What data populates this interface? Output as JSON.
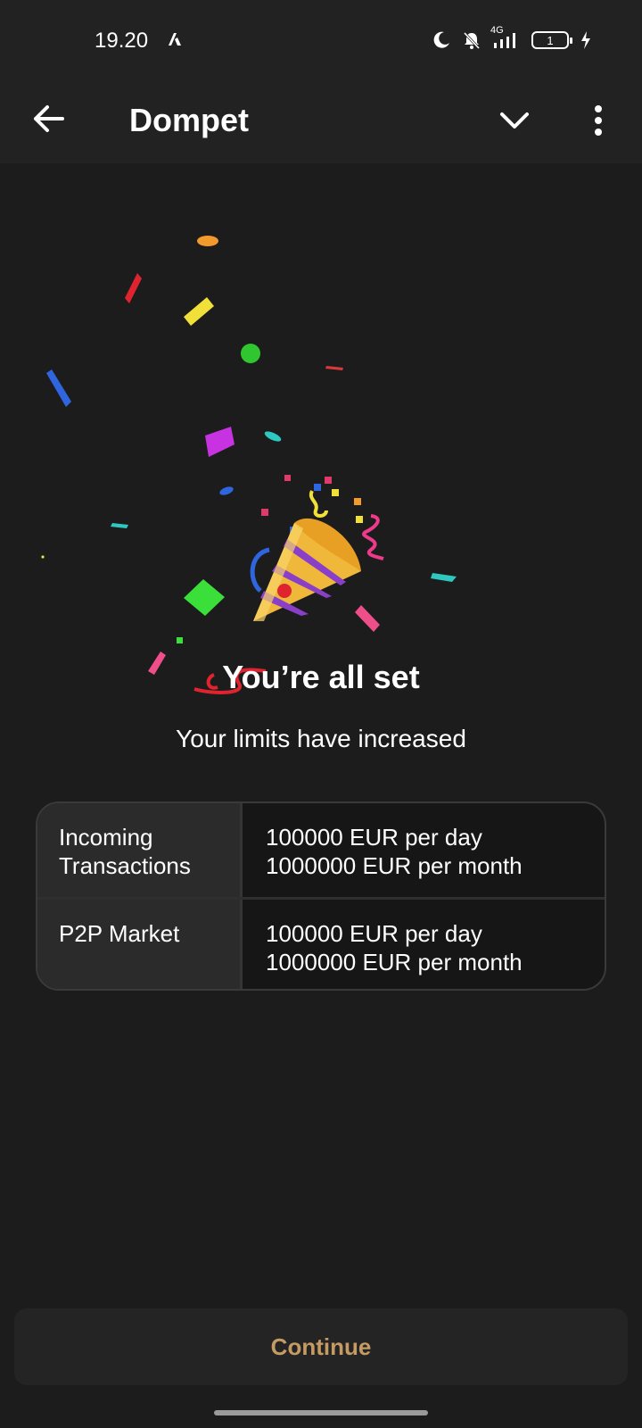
{
  "status_bar": {
    "time": "19.20",
    "network": "4G",
    "battery_level": "1"
  },
  "app_bar": {
    "title": "Dompet",
    "back_icon": "arrow-left-icon",
    "dropdown_icon": "chevron-down-icon",
    "menu_icon": "more-vertical-icon"
  },
  "celebration": {
    "icon": "party-popper-icon"
  },
  "main": {
    "title": "You’re all set",
    "subtitle": "Your limits have increased"
  },
  "limits": {
    "rows": [
      {
        "label_line1": "Incoming",
        "label_line2": "Transactions",
        "value_line1": "100000 EUR per day",
        "value_line2": "1000000 EUR per month"
      },
      {
        "label_line1": "P2P Market",
        "label_line2": "",
        "value_line1": "100000 EUR per day",
        "value_line2": "1000000 EUR per month"
      }
    ]
  },
  "footer": {
    "continue_label": "Continue"
  },
  "colors": {
    "background": "#1c1c1c",
    "bar": "#222222",
    "accent": "#c59a63"
  }
}
